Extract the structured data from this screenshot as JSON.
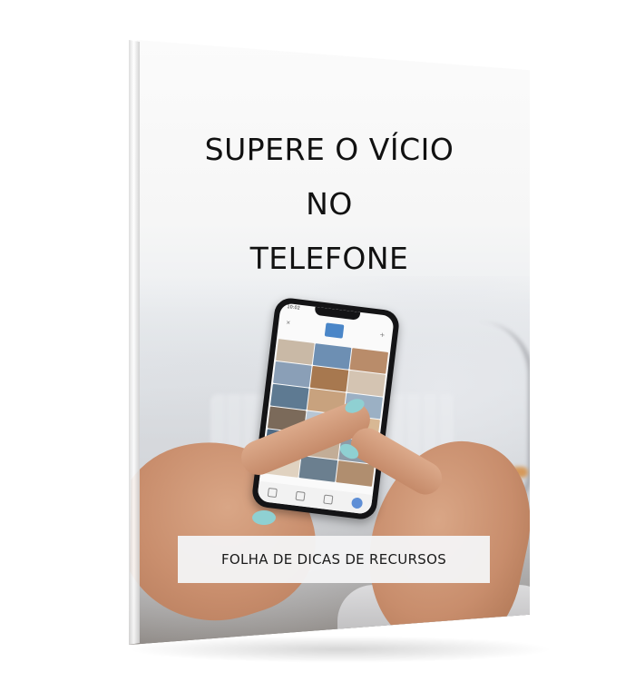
{
  "cover": {
    "title_lines": [
      "SUPERE O VÍCIO",
      "NO",
      "TELEFONE"
    ],
    "banner_text": "FOLHA DE DICAS DE RECURSOS"
  },
  "phone": {
    "status_time": "10:02",
    "photo_tile_colors": [
      "#c9b9a6",
      "#6d8fb3",
      "#b98c6a",
      "#8a9fb7",
      "#a7784f",
      "#d4c4b2",
      "#5e7a92",
      "#c8a27e",
      "#9bb0c4",
      "#7b6a5a",
      "#b7c6d4",
      "#d8b894",
      "#4f6b85",
      "#c2ad97",
      "#8c9aa7",
      "#e0d2c0",
      "#6b7f8f",
      "#b08e6f"
    ]
  },
  "colors": {
    "nail": "#8fd0d2",
    "title_text": "#111111"
  }
}
